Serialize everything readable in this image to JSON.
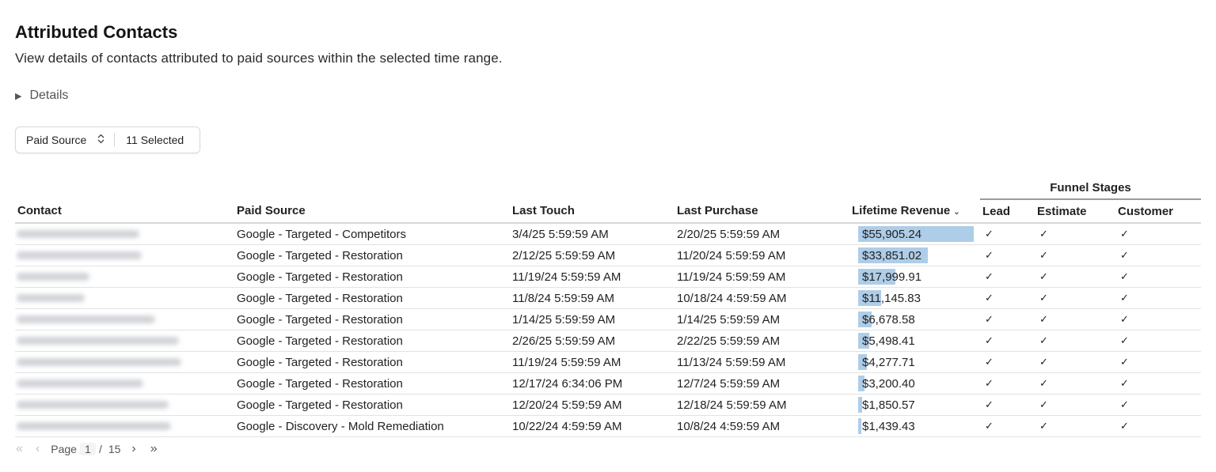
{
  "header": {
    "title": "Attributed Contacts",
    "subtitle": "View details of contacts attributed to paid sources within the selected time range.",
    "details_label": "Details"
  },
  "filter": {
    "label": "Paid Source",
    "selected_text": "11 Selected"
  },
  "table": {
    "group_header": "Funnel Stages",
    "columns": {
      "contact": "Contact",
      "paid_source": "Paid Source",
      "last_touch": "Last Touch",
      "last_purchase": "Last Purchase",
      "lifetime_revenue": "Lifetime Revenue",
      "lead": "Lead",
      "estimate": "Estimate",
      "customer": "Customer"
    },
    "check_glyph": "✓",
    "revenue_max": 55905.24,
    "rows": [
      {
        "paid_source": "Google - Targeted - Competitors",
        "last_touch": "3/4/25 5:59:59 AM",
        "last_purchase": "2/20/25 5:59:59 AM",
        "revenue": "$55,905.24",
        "revenue_value": 55905.24
      },
      {
        "paid_source": "Google - Targeted - Restoration",
        "last_touch": "2/12/25 5:59:59 AM",
        "last_purchase": "11/20/24 5:59:59 AM",
        "revenue": "$33,851.02",
        "revenue_value": 33851.02
      },
      {
        "paid_source": "Google - Targeted - Restoration",
        "last_touch": "11/19/24 5:59:59 AM",
        "last_purchase": "11/19/24 5:59:59 AM",
        "revenue": "$17,999.91",
        "revenue_value": 17999.91
      },
      {
        "paid_source": "Google - Targeted - Restoration",
        "last_touch": "11/8/24 5:59:59 AM",
        "last_purchase": "10/18/24 4:59:59 AM",
        "revenue": "$11,145.83",
        "revenue_value": 11145.83
      },
      {
        "paid_source": "Google - Targeted - Restoration",
        "last_touch": "1/14/25 5:59:59 AM",
        "last_purchase": "1/14/25 5:59:59 AM",
        "revenue": "$6,678.58",
        "revenue_value": 6678.58
      },
      {
        "paid_source": "Google - Targeted - Restoration",
        "last_touch": "2/26/25 5:59:59 AM",
        "last_purchase": "2/22/25 5:59:59 AM",
        "revenue": "$5,498.41",
        "revenue_value": 5498.41
      },
      {
        "paid_source": "Google - Targeted - Restoration",
        "last_touch": "11/19/24 5:59:59 AM",
        "last_purchase": "11/13/24 5:59:59 AM",
        "revenue": "$4,277.71",
        "revenue_value": 4277.71
      },
      {
        "paid_source": "Google - Targeted - Restoration",
        "last_touch": "12/17/24 6:34:06 PM",
        "last_purchase": "12/7/24 5:59:59 AM",
        "revenue": "$3,200.40",
        "revenue_value": 3200.4
      },
      {
        "paid_source": "Google - Targeted - Restoration",
        "last_touch": "12/20/24 5:59:59 AM",
        "last_purchase": "12/18/24 5:59:59 AM",
        "revenue": "$1,850.57",
        "revenue_value": 1850.57
      },
      {
        "paid_source": "Google - Discovery - Mold Remediation",
        "last_touch": "10/22/24 4:59:59 AM",
        "last_purchase": "10/8/24 4:59:59 AM",
        "revenue": "$1,439.43",
        "revenue_value": 1439.43
      }
    ]
  },
  "pagination": {
    "page_label": "Page",
    "current_page": "1",
    "separator": "/",
    "total_pages": "15"
  }
}
